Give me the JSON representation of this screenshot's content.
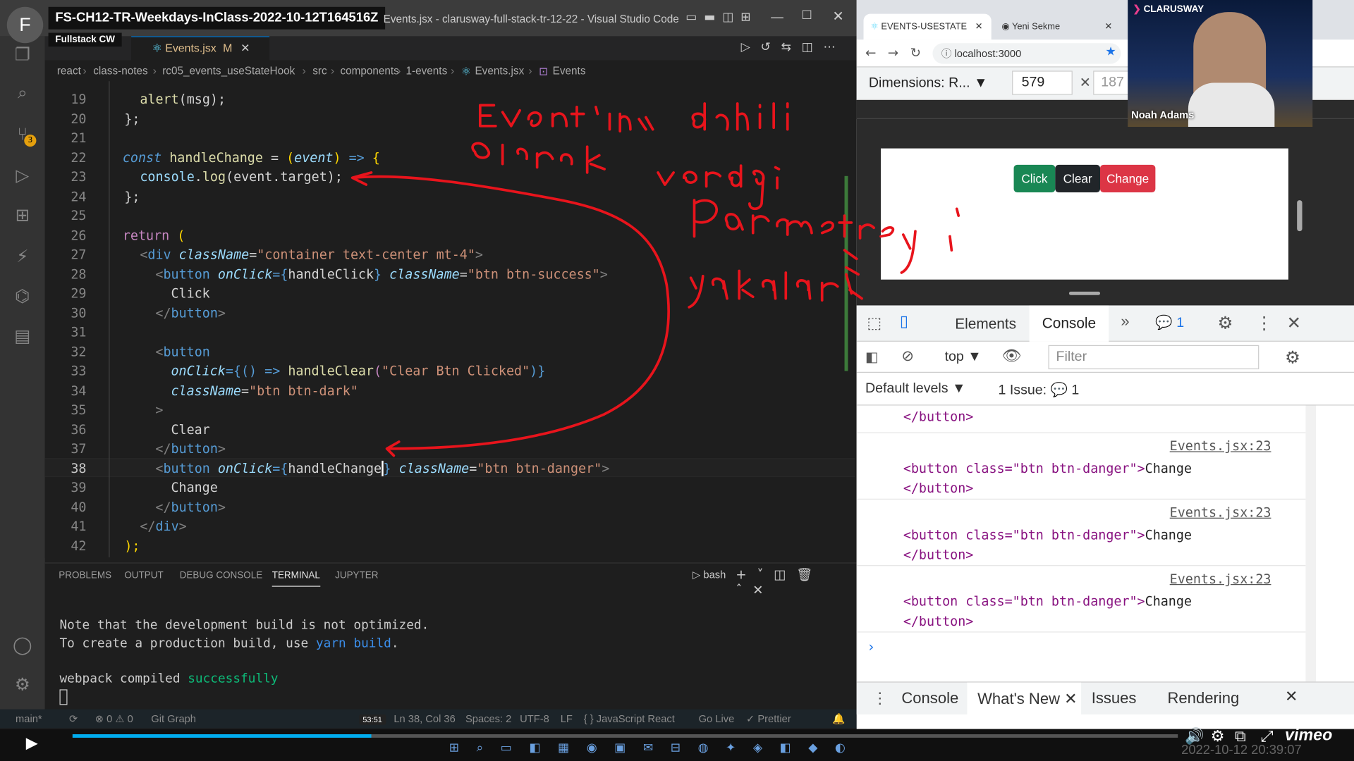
{
  "vscode": {
    "title_session": "FS-CH12-TR-Weekdays-InClass-2022-10-12T164516Z",
    "title": "Events.jsx - clarusway-full-stack-tr-12-22 - Visual Studio Code",
    "tooltip": "Fullstack CW",
    "avatar_letter": "F",
    "scm_badge": "3",
    "tab_label": "Events.jsx",
    "tab_modified": "M",
    "breadcrumb": [
      "react",
      "class-notes",
      "rc05_events_useStateHook",
      "src",
      "components",
      "1-events",
      "Events.jsx",
      "Events"
    ],
    "line_numbers": [
      "19",
      "20",
      "21",
      "22",
      "23",
      "24",
      "25",
      "26",
      "27",
      "28",
      "29",
      "30",
      "31",
      "32",
      "33",
      "34",
      "35",
      "36",
      "37",
      "38",
      "39",
      "40",
      "41",
      "42"
    ],
    "code": {
      "l19": [
        "alert",
        "(msg);"
      ],
      "l20": "};",
      "l22": [
        "const",
        "handleChange",
        "=",
        "(",
        "event",
        ")",
        "=>",
        "{"
      ],
      "l23": [
        "console",
        ".",
        "log",
        "(event.target);"
      ],
      "l24": "};",
      "l26": [
        "return",
        "("
      ],
      "l27": [
        "<",
        "div",
        "className",
        "=",
        "\"container text-center mt-4\"",
        ">"
      ],
      "l28": [
        "<",
        "button",
        "onClick",
        "={",
        "handleClick",
        "}",
        "className",
        "=",
        "\"btn btn-success\"",
        ">"
      ],
      "l29": "Click",
      "l30": [
        "</",
        "button",
        ">"
      ],
      "l32": [
        "<",
        "button"
      ],
      "l33": [
        "onClick",
        "={() =>",
        "handleClear",
        "(",
        "\"Clear Btn Clicked\"",
        ")}"
      ],
      "l34": [
        "className",
        "=",
        "\"btn btn-dark\""
      ],
      "l35": ">",
      "l36": "Clear",
      "l37": [
        "</",
        "button",
        ">"
      ],
      "l38": [
        "<",
        "button",
        "onClick",
        "={",
        "handleChange",
        "}",
        "className",
        "=",
        "\"btn btn-danger\"",
        ">"
      ],
      "l39": "Change",
      "l40": [
        "</",
        "button",
        ">"
      ],
      "l41": [
        "</",
        "div",
        ">"
      ],
      "l42": ");"
    },
    "panel_tabs": [
      "PROBLEMS",
      "OUTPUT",
      "DEBUG CONSOLE",
      "TERMINAL",
      "JUPYTER"
    ],
    "panel_active": "TERMINAL",
    "shell": "bash",
    "terminal": {
      "line1": "Note that the development build is not optimized.",
      "line2a": "To create a production build, use ",
      "line2b": "yarn build",
      "line2c": ".",
      "line3a": "webpack compiled ",
      "line3b": "successfully"
    },
    "status": {
      "branch": "main*",
      "errors": "⊗ 0 ⚠ 0",
      "gitgraph": "Git Graph",
      "position": "Ln 38, Col 36",
      "spaces": "Spaces: 2",
      "encoding": "UTF-8",
      "eol": "LF",
      "language": "{ } JavaScript React",
      "golive": "Go Live",
      "prettier": "✓ Prettier"
    }
  },
  "browser": {
    "tab1": "EVENTS-USESTATE",
    "tab2": "Yeni Sekme",
    "url": "localhost:3000",
    "dimensions_label": "Dimensions: R...",
    "width": "579",
    "height": "187",
    "buttons": {
      "click": "Click",
      "clear": "Clear",
      "change": "Change"
    },
    "colors": {
      "success": "#198754",
      "dark": "#212529",
      "danger": "#dc3545"
    },
    "devtools_tabs": [
      "Elements",
      "Console"
    ],
    "devtools_active": "Console",
    "issues_badge": "1",
    "context": "top",
    "filter_placeholder": "Filter",
    "levels": "Default levels",
    "issues_label": "1 Issue:",
    "issues_count": "1",
    "logs": [
      {
        "source": "Events.jsx:23",
        "open": "<button class=\"btn btn-danger\">",
        "text": "Change",
        "close": "</button>"
      },
      {
        "source": "Events.jsx:23",
        "open": "<button class=\"btn btn-danger\">",
        "text": "Change",
        "close": "</button>"
      },
      {
        "source": "Events.jsx:23",
        "open": "<button class=\"btn btn-danger\">",
        "text": "Change",
        "close": "</button>"
      }
    ],
    "drawer_tabs": [
      "Console",
      "What's New",
      "Issues",
      "Rendering"
    ],
    "drawer_active": "What's New"
  },
  "webcam": {
    "brand": "CLARUSWAY",
    "name": "Noah Adams"
  },
  "video": {
    "time_tooltip": "53:51",
    "timestamp": "2022-10-12 20:39:07",
    "brand": "vimeo"
  },
  "annotation_words": [
    "Event'in",
    "dahili",
    "olarak",
    "verdiği",
    "parametreyi",
    "yakalar"
  ]
}
